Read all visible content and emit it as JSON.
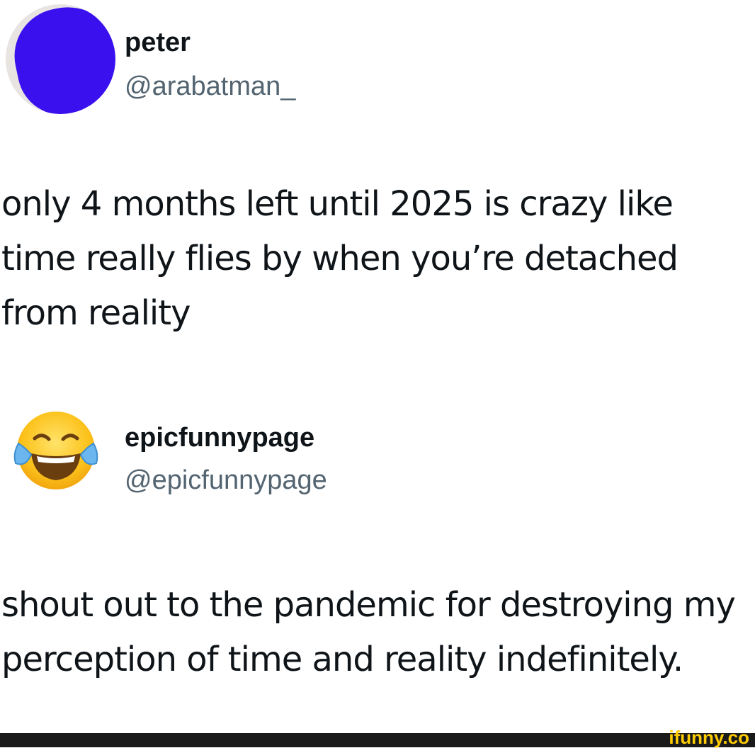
{
  "tweets": [
    {
      "display_name": "peter",
      "handle": "@arabatman_",
      "text": "only 4 months left until 2025 is crazy like time really flies by when you’re detached from reality",
      "avatar_icon": "scribbled-out-avatar",
      "avatar_color": "#3a10ef"
    },
    {
      "display_name": "epicfunnypage",
      "handle": "@epicfunnypage",
      "text": "shout out to the pandemic  for destroying my perception of time and reality indefinitely.",
      "avatar_icon": "face-with-tears-of-joy-emoji"
    }
  ],
  "watermark": {
    "text": "ifunny.co",
    "color": "#ffcc00"
  },
  "colors": {
    "text_primary": "#0f1419",
    "text_secondary": "#536471",
    "background": "#ffffff"
  }
}
